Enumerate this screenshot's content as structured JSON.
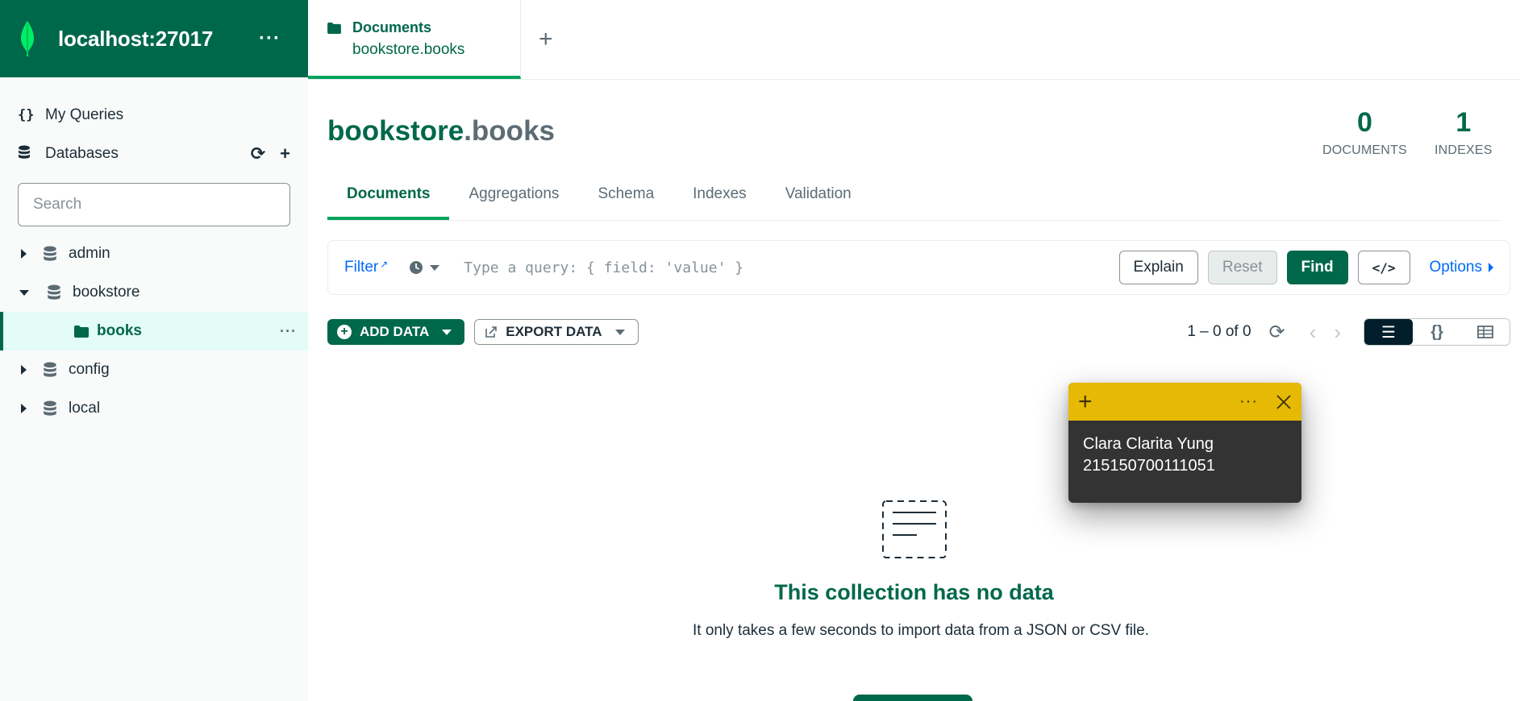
{
  "sidebar": {
    "connection": "localhost:27017",
    "nav": {
      "my_queries": "My Queries",
      "databases": "Databases"
    },
    "search_placeholder": "Search",
    "databases": [
      {
        "name": "admin",
        "expanded": false
      },
      {
        "name": "bookstore",
        "expanded": true,
        "collections": [
          "books"
        ]
      },
      {
        "name": "config",
        "expanded": false
      },
      {
        "name": "local",
        "expanded": false
      }
    ]
  },
  "workspace_tab": {
    "title": "Documents",
    "namespace": "bookstore.books"
  },
  "collection": {
    "db": "bookstore",
    "sep_name": ".books",
    "documents_count": "0",
    "documents_label": "DOCUMENTS",
    "indexes_count": "1",
    "indexes_label": "INDEXES"
  },
  "sub_tabs": [
    "Documents",
    "Aggregations",
    "Schema",
    "Indexes",
    "Validation"
  ],
  "query": {
    "filter_label": "Filter",
    "placeholder": "Type a query: { field: 'value' }",
    "explain": "Explain",
    "reset": "Reset",
    "find": "Find",
    "code": "</>",
    "options": "Options"
  },
  "toolbar": {
    "add_data": "ADD DATA",
    "export_data": "EXPORT DATA",
    "pagination": "1 – 0 of 0"
  },
  "empty_state": {
    "title": "This collection has no data",
    "description": "It only takes a few seconds to import data from a JSON or CSV file."
  },
  "sticky_note": {
    "line1": "Clara Clarita Yung",
    "line2": "215150700111051"
  },
  "colors": {
    "brand": "#00684a",
    "accent": "#00a35c",
    "link": "#016bf8",
    "sticky": "#e6b905"
  }
}
